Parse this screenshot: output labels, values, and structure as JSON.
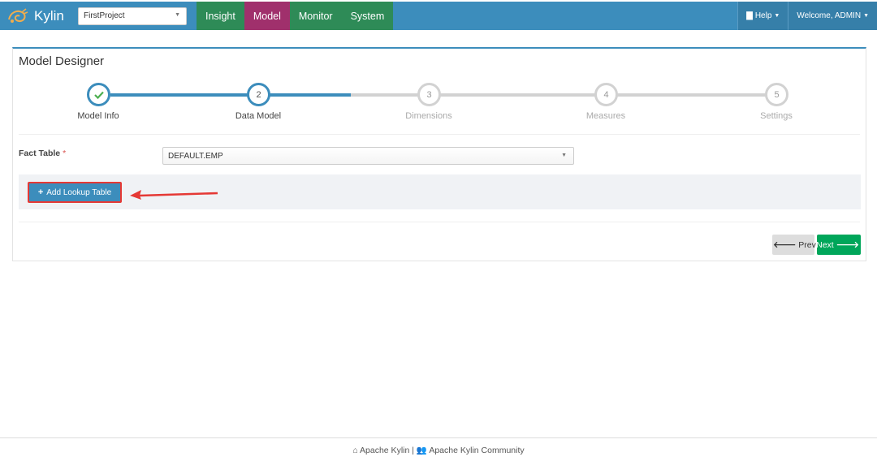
{
  "app": {
    "brand": "Kylin"
  },
  "project_select": {
    "value": "FirstProject"
  },
  "nav": {
    "tabs": [
      {
        "label": "Insight",
        "active": false
      },
      {
        "label": "Model",
        "active": true
      },
      {
        "label": "Monitor",
        "active": false
      },
      {
        "label": "System",
        "active": false
      }
    ],
    "help_label": "Help",
    "user_label": "Welcome, ADMIN"
  },
  "panel": {
    "title": "Model Designer"
  },
  "wizard": {
    "steps": [
      {
        "number": "",
        "label": "Model Info",
        "state": "done"
      },
      {
        "number": "2",
        "label": "Data Model",
        "state": "active"
      },
      {
        "number": "3",
        "label": "Dimensions",
        "state": "pending"
      },
      {
        "number": "4",
        "label": "Measures",
        "state": "pending"
      },
      {
        "number": "5",
        "label": "Settings",
        "state": "pending"
      }
    ]
  },
  "form": {
    "fact_table_label": "Fact Table",
    "required_mark": "*",
    "fact_table_value": "DEFAULT.EMP",
    "add_lookup_label": "Add Lookup Table"
  },
  "buttons": {
    "prev": "Prev",
    "next": "Next"
  },
  "footer": {
    "left": "Apache Kylin",
    "separator": "|",
    "right": "Apache Kylin Community"
  },
  "colors": {
    "nav_bg": "#3c8dbc",
    "nav_tab": "#2e8b57",
    "nav_tab_active": "#a0306c",
    "accent": "#3c8dbc",
    "success": "#00a65a",
    "highlight": "#e53935"
  }
}
